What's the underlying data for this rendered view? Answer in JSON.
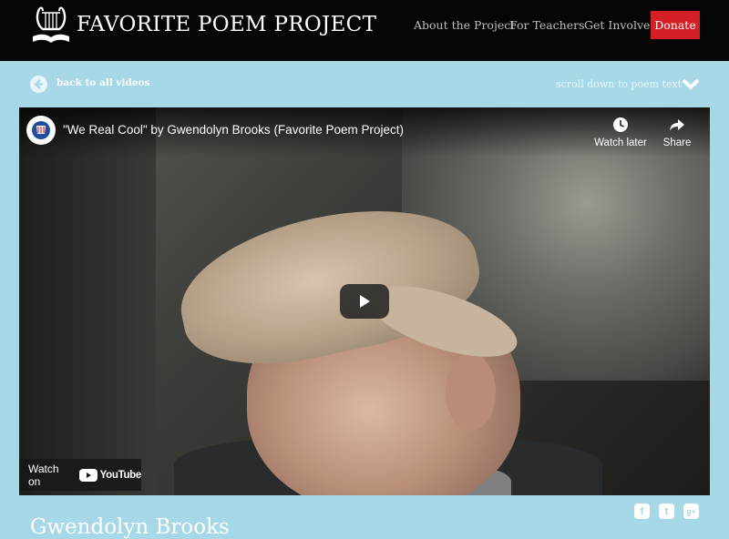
{
  "header": {
    "site_title": "FAVORITE POEM PROJECT",
    "nav": [
      "About the Project",
      "For Teachers",
      "Get Involved"
    ],
    "donate_label": "Donate"
  },
  "subnav": {
    "back_label": "back to all videos",
    "scroll_label": "scroll down to poem text"
  },
  "video": {
    "title": "\"We Real Cool\" by Gwendolyn Brooks (Favorite Poem Project)",
    "watch_later_label": "Watch later",
    "share_label": "Share",
    "watch_on_label": "Watch on",
    "youtube_label": "YouTube"
  },
  "social": {
    "facebook": "f",
    "twitter": "t",
    "googleplus": "g+"
  },
  "poet_name": "Gwendolyn Brooks",
  "colors": {
    "header_bg": "#050505",
    "page_bg": "#a6d8e8",
    "donate_bg": "#d51f26"
  },
  "icons": [
    "lyre-book-logo-icon",
    "back-arrow-icon",
    "chevron-down-icon",
    "clock-icon",
    "share-arrow-icon",
    "play-icon",
    "youtube-icon",
    "facebook-icon",
    "twitter-icon",
    "googleplus-icon"
  ]
}
